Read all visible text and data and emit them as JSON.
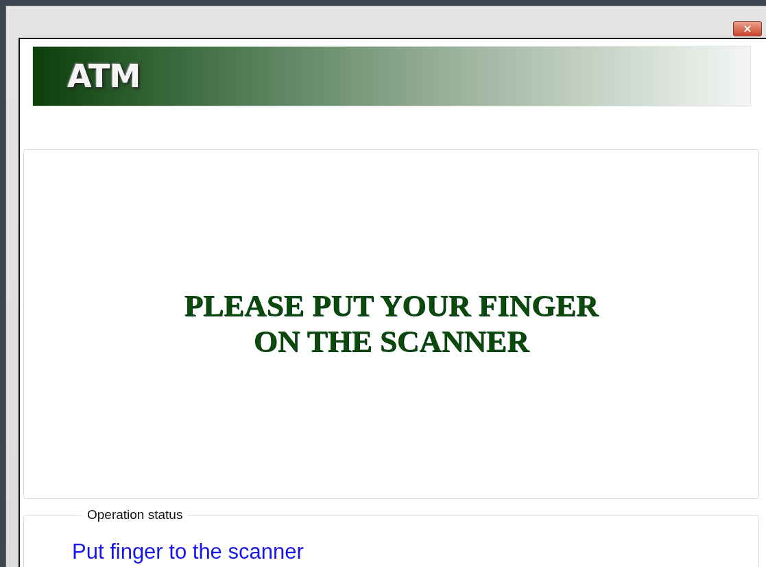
{
  "window": {
    "close_glyph": "×"
  },
  "banner": {
    "logo": "ATM"
  },
  "prompt": {
    "lines": [
      "PLEASE PUT YOUR FINGER",
      "ON THE SCANNER"
    ]
  },
  "status_group": {
    "legend": "Operation status",
    "message": "Put finger to the scanner"
  }
}
